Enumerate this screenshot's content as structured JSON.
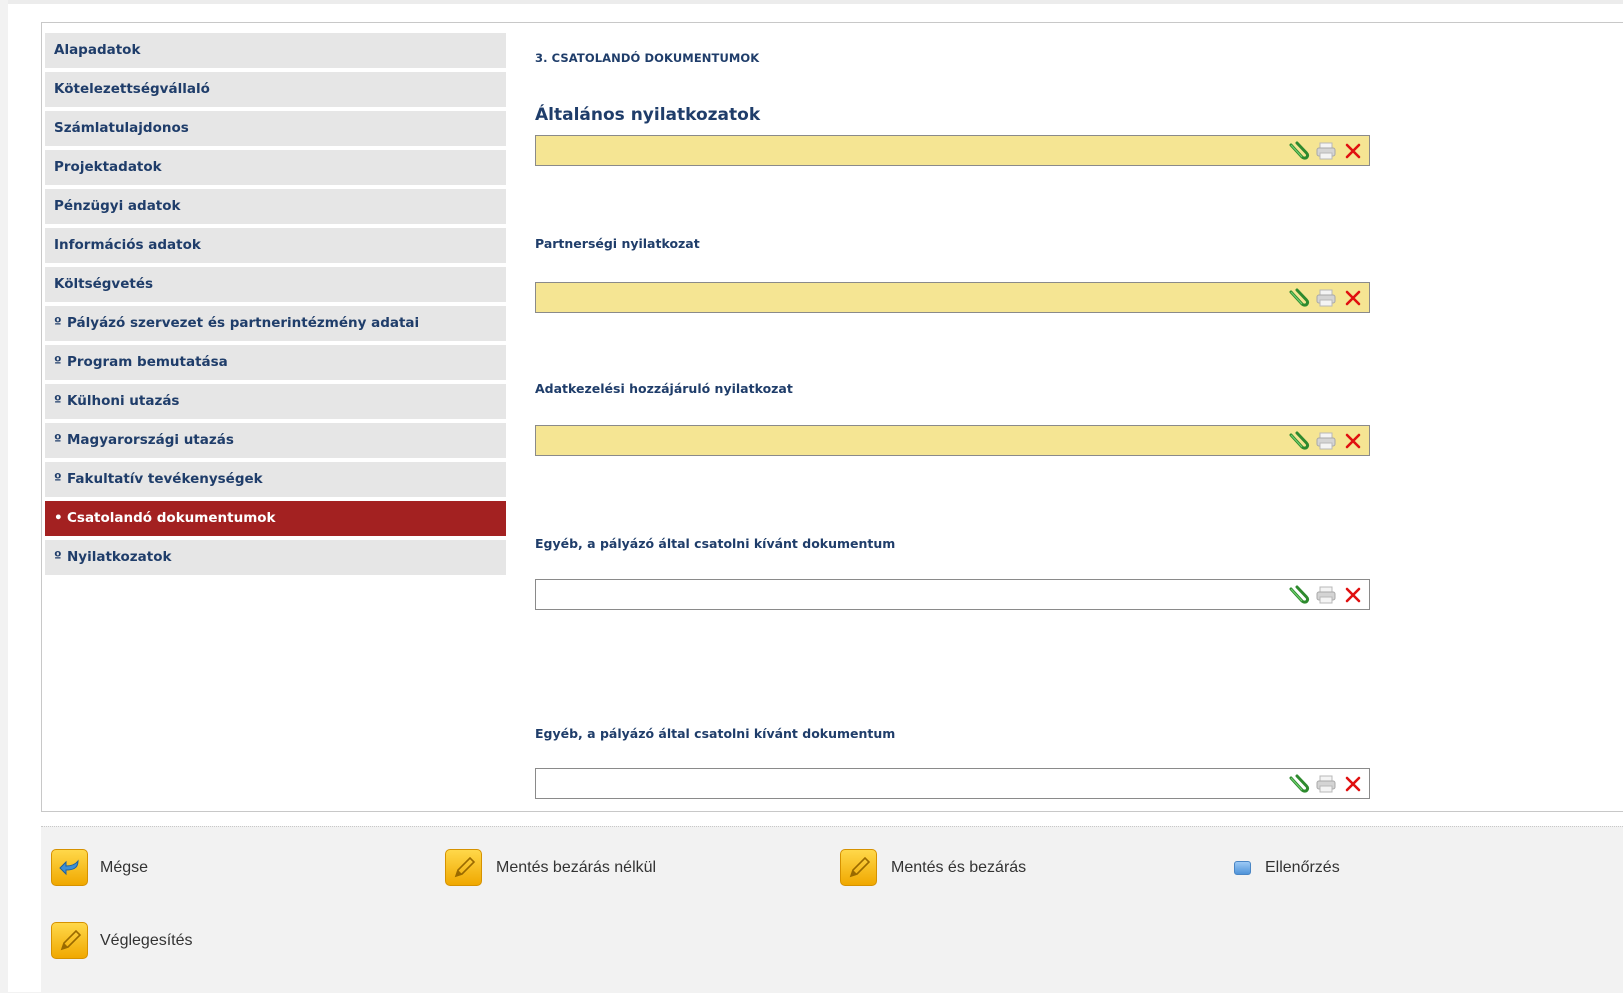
{
  "sidebar": {
    "items": [
      {
        "label": "Alapadatok",
        "marker": "",
        "active": false
      },
      {
        "label": "Kötelezettségvállaló",
        "marker": "",
        "active": false
      },
      {
        "label": "Számlatulajdonos",
        "marker": "",
        "active": false
      },
      {
        "label": "Projektadatok",
        "marker": "",
        "active": false
      },
      {
        "label": "Pénzügyi adatok",
        "marker": "",
        "active": false
      },
      {
        "label": "Információs adatok",
        "marker": "",
        "active": false
      },
      {
        "label": "Költségvetés",
        "marker": "",
        "active": false
      },
      {
        "label": "Pályázó szervezet és partnerintézmény adatai",
        "marker": "º",
        "active": false
      },
      {
        "label": "Program bemutatása",
        "marker": "º",
        "active": false
      },
      {
        "label": "Külhoni utazás",
        "marker": "º",
        "active": false
      },
      {
        "label": "Magyarországi utazás",
        "marker": "º",
        "active": false
      },
      {
        "label": "Fakultatív tevékenységek",
        "marker": "º",
        "active": false
      },
      {
        "label": "Csatolandó dokumentumok",
        "marker": "•",
        "active": true
      },
      {
        "label": "Nyilatkozatok",
        "marker": "º",
        "active": false
      }
    ]
  },
  "main": {
    "section_title": "3. CSATOLANDÓ DOKUMENTUMOK",
    "group_heading": "Általános nyilatkozatok",
    "fields": [
      {
        "label": "",
        "required": true
      },
      {
        "label": "Partnerségi nyilatkozat",
        "required": true
      },
      {
        "label": "Adatkezelési hozzájáruló nyilatkozat",
        "required": true
      },
      {
        "label": "Egyéb, a pályázó által csatolni kívánt dokumentum",
        "required": false
      },
      {
        "label": "Egyéb, a pályázó által csatolni kívánt dokumentum",
        "required": false
      }
    ],
    "icons": [
      "attach-icon",
      "print-icon",
      "delete-icon"
    ]
  },
  "footer": {
    "cancel": "Mégse",
    "save_no_close": "Mentés bezárás nélkül",
    "save_close": "Mentés és bezárás",
    "check": "Ellenőrzés",
    "finalize": "Véglegesítés"
  },
  "colors": {
    "nav_bg": "#e6e6e6",
    "nav_active": "#a32121",
    "text_navy": "#1f3d6a",
    "required_field": "#f5e593"
  }
}
